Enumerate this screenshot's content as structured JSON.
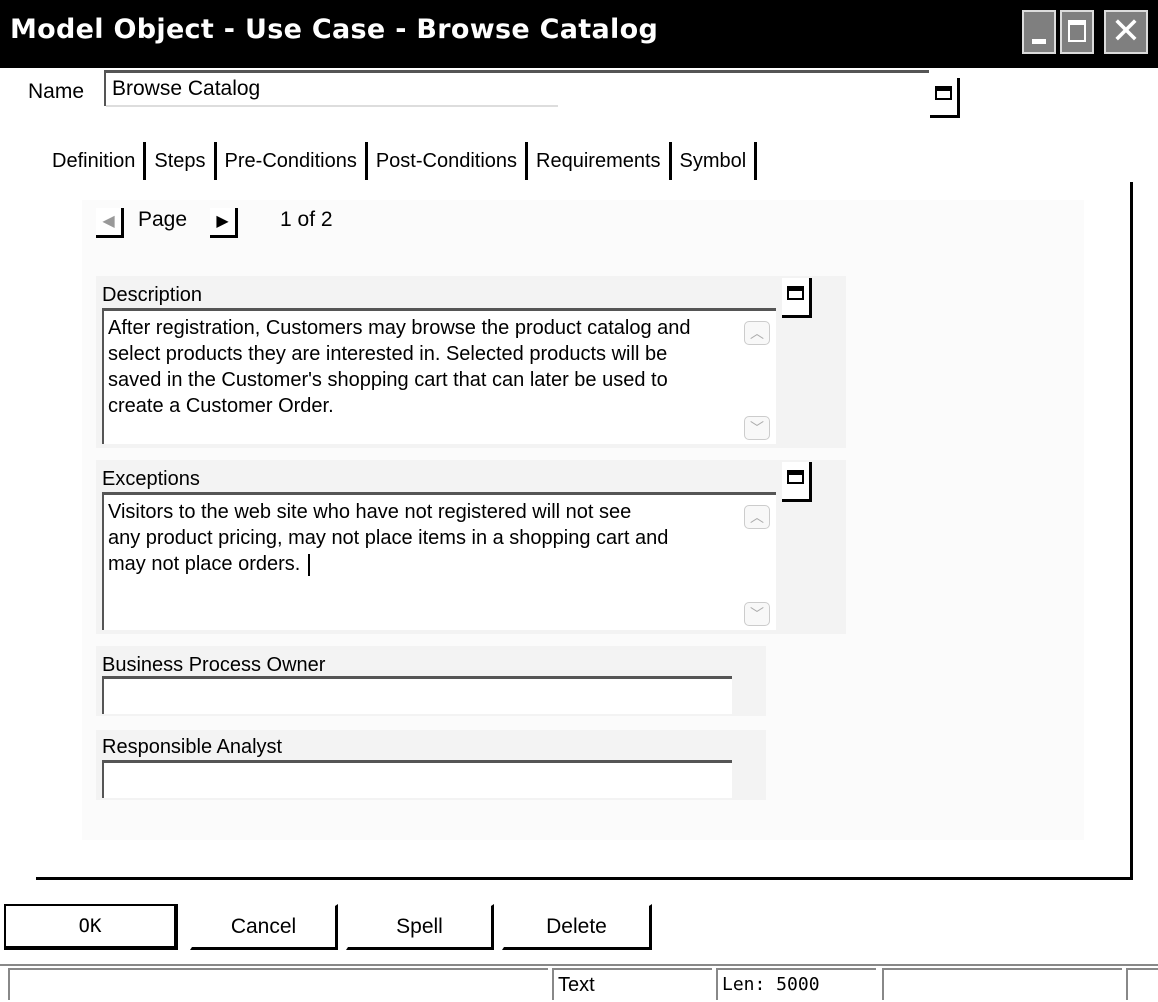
{
  "window": {
    "title": "Model Object - Use Case - Browse Catalog"
  },
  "name_field": {
    "label": "Name",
    "value": "Browse Catalog"
  },
  "tabs": [
    {
      "label": "Definition",
      "active": true
    },
    {
      "label": "Steps",
      "active": false
    },
    {
      "label": "Pre-Conditions",
      "active": false
    },
    {
      "label": "Post-Conditions",
      "active": false
    },
    {
      "label": "Requirements",
      "active": false
    },
    {
      "label": "Symbol",
      "active": false
    }
  ],
  "paging": {
    "label": "Page",
    "count": "1 of 2"
  },
  "description": {
    "label": "Description",
    "lines": [
      "After registration, Customers may browse the product catalog and",
      "select products they are interested in. Selected products will be",
      "saved in the Customer's shopping cart that can later be used to",
      "create a Customer Order."
    ]
  },
  "exceptions": {
    "label": "Exceptions",
    "lines": [
      "Visitors to the web site who have not registered will not see",
      "any product pricing, may not place items in a shopping cart and",
      "may not place orders. "
    ]
  },
  "business_process_owner": {
    "label": "Business Process Owner",
    "value": ""
  },
  "responsible_analyst": {
    "label": "Responsible Analyst",
    "value": ""
  },
  "buttons": {
    "ok": "OK",
    "cancel": "Cancel",
    "spell": "Spell",
    "delete": "Delete"
  },
  "statusbar": {
    "mode": "Text",
    "len": "Len: 5000"
  },
  "icons": {
    "minimize": "minimize-icon",
    "maximize": "maximize-icon",
    "close": "close-icon",
    "popup": "popup-window-icon",
    "prev": "arrow-left-icon",
    "next": "arrow-right-icon",
    "scroll_up": "chevron-up-icon",
    "scroll_down": "chevron-down-icon"
  }
}
